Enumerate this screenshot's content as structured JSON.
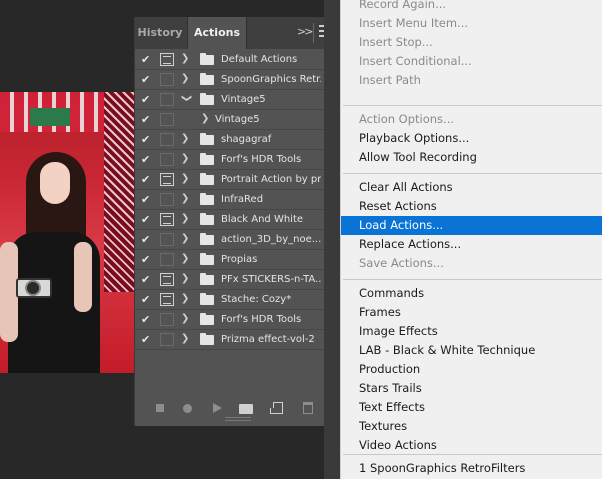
{
  "panel": {
    "tabs": [
      {
        "label": "History",
        "active": false
      },
      {
        "label": "Actions",
        "active": true
      }
    ],
    "actions": [
      {
        "name": "Default Actions",
        "checked": true,
        "dialog": true,
        "expanded": false,
        "level": 0
      },
      {
        "name": "SpoonGraphics Retr...",
        "checked": true,
        "dialog": false,
        "expanded": false,
        "level": 0
      },
      {
        "name": "Vintage5",
        "checked": true,
        "dialog": false,
        "expanded": true,
        "level": 0
      },
      {
        "name": "Vintage5",
        "checked": true,
        "dialog": false,
        "expanded": false,
        "level": 1
      },
      {
        "name": "shagagraf",
        "checked": true,
        "dialog": false,
        "expanded": false,
        "level": 0
      },
      {
        "name": "Forf's HDR Tools",
        "checked": true,
        "dialog": false,
        "expanded": false,
        "level": 0
      },
      {
        "name": "Portrait Action by pr...",
        "checked": true,
        "dialog": true,
        "expanded": false,
        "level": 0
      },
      {
        "name": "InfraRed",
        "checked": true,
        "dialog": false,
        "expanded": false,
        "level": 0
      },
      {
        "name": "Black And White",
        "checked": true,
        "dialog": true,
        "expanded": false,
        "level": 0
      },
      {
        "name": "action_3D_by_noe...",
        "checked": true,
        "dialog": false,
        "expanded": false,
        "level": 0
      },
      {
        "name": "Propias",
        "checked": true,
        "dialog": false,
        "expanded": false,
        "level": 0
      },
      {
        "name": "PFx STICKERS-n-TA...",
        "checked": true,
        "dialog": true,
        "expanded": false,
        "level": 0
      },
      {
        "name": "Stache: Cozy*",
        "checked": true,
        "dialog": true,
        "expanded": false,
        "level": 0
      },
      {
        "name": "Forf's HDR Tools",
        "checked": true,
        "dialog": false,
        "expanded": false,
        "level": 0
      },
      {
        "name": "Prizma effect-vol-2",
        "checked": true,
        "dialog": false,
        "expanded": false,
        "level": 0
      }
    ],
    "footer_icons": [
      "stop-icon",
      "record-icon",
      "play-icon",
      "new-set-icon",
      "new-action-icon",
      "delete-icon"
    ]
  },
  "menu": {
    "groups": [
      [
        {
          "label": "Record Again...",
          "disabled": true
        },
        {
          "label": "Insert Menu Item...",
          "disabled": true
        },
        {
          "label": "Insert Stop...",
          "disabled": true
        },
        {
          "label": "Insert Conditional...",
          "disabled": true
        },
        {
          "label": "Insert Path",
          "disabled": true
        }
      ],
      [
        {
          "label": "Action Options...",
          "disabled": true
        },
        {
          "label": "Playback Options...",
          "disabled": false
        },
        {
          "label": "Allow Tool Recording",
          "disabled": false
        }
      ],
      [
        {
          "label": "Clear All Actions",
          "disabled": false
        },
        {
          "label": "Reset Actions",
          "disabled": false
        },
        {
          "label": "Load Actions...",
          "disabled": false,
          "selected": true
        },
        {
          "label": "Replace Actions...",
          "disabled": false
        },
        {
          "label": "Save Actions...",
          "disabled": true
        }
      ],
      [
        {
          "label": "Commands",
          "disabled": false
        },
        {
          "label": "Frames",
          "disabled": false
        },
        {
          "label": "Image Effects",
          "disabled": false
        },
        {
          "label": "LAB - Black & White Technique",
          "disabled": false
        },
        {
          "label": "Production",
          "disabled": false
        },
        {
          "label": "Stars Trails",
          "disabled": false
        },
        {
          "label": "Text Effects",
          "disabled": false
        },
        {
          "label": "Textures",
          "disabled": false
        },
        {
          "label": "Video Actions",
          "disabled": false
        }
      ],
      [
        {
          "label": "1 SpoonGraphics RetroFilters",
          "disabled": false
        }
      ]
    ]
  },
  "colors": {
    "panel_bg": "#535353",
    "menu_bg": "#f0f0f0",
    "selection": "#0a73d6"
  }
}
